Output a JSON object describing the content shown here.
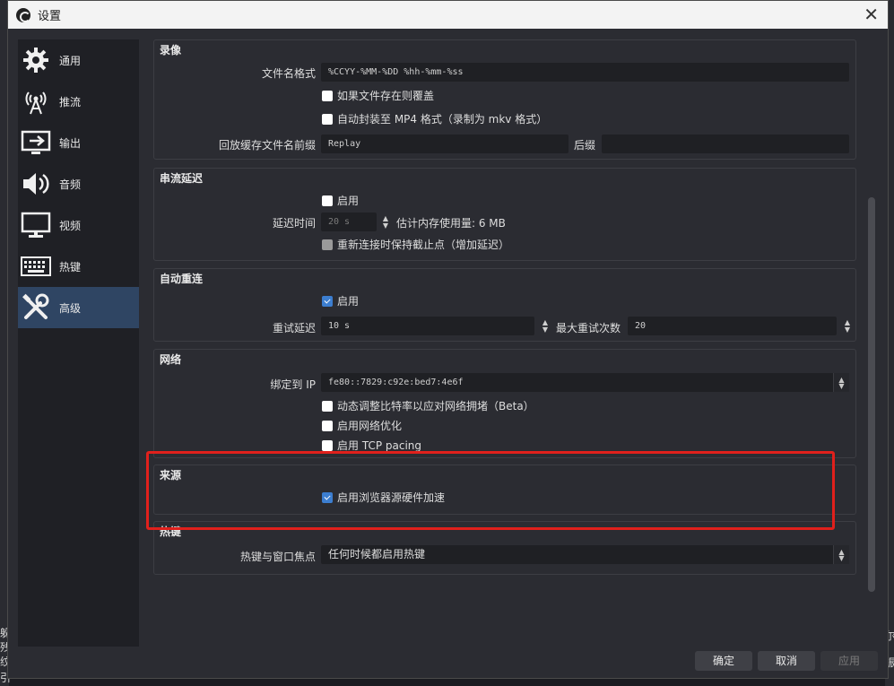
{
  "background": {
    "left_fragments": [
      "躲",
      "残",
      "纹",
      "引未弗"
    ],
    "right_fragments": [
      "尔",
      "振"
    ]
  },
  "window": {
    "title": "设置",
    "close_glyph": "✕"
  },
  "sidebar": {
    "items": [
      {
        "label": "通用",
        "icon": "gear-icon"
      },
      {
        "label": "推流",
        "icon": "antenna-icon"
      },
      {
        "label": "输出",
        "icon": "output-icon"
      },
      {
        "label": "音频",
        "icon": "speaker-icon"
      },
      {
        "label": "视频",
        "icon": "monitor-icon"
      },
      {
        "label": "热键",
        "icon": "keyboard-icon"
      },
      {
        "label": "高级",
        "icon": "tools-icon",
        "active": true
      }
    ]
  },
  "recording": {
    "title": "录像",
    "filename_format_label": "文件名格式",
    "filename_format_value": "%CCYY-%MM-%DD %hh-%mm-%ss",
    "overwrite_label": "如果文件存在则覆盖",
    "overwrite_checked": false,
    "remux_label": "自动封装至 MP4 格式（录制为 mkv 格式）",
    "remux_checked": false,
    "replay_prefix_label": "回放缓存文件名前缀",
    "replay_prefix_value": "Replay",
    "suffix_label": "后缀",
    "suffix_value": ""
  },
  "stream_delay": {
    "title": "串流延迟",
    "enable_label": "启用",
    "enable_checked": false,
    "delay_label": "延迟时间",
    "delay_value": "20 s",
    "memory_estimate": "估计内存使用量: 6 MB",
    "preserve_label": "重新连接时保持截止点（增加延迟）",
    "preserve_checked": true
  },
  "auto_reconnect": {
    "title": "自动重连",
    "enable_label": "启用",
    "enable_checked": true,
    "retry_delay_label": "重试延迟",
    "retry_delay_value": "10 s",
    "max_retries_label": "最大重试次数",
    "max_retries_value": "20"
  },
  "network": {
    "title": "网络",
    "bind_ip_label": "绑定到 IP",
    "bind_ip_value": "fe80::7829:c92e:bed7:4e6f",
    "dynamic_bitrate_label": "动态调整比特率以应对网络拥堵（Beta）",
    "dynamic_bitrate_checked": false,
    "net_opt_label": "启用网络优化",
    "net_opt_checked": false,
    "tcp_pacing_label": "启用 TCP pacing",
    "tcp_pacing_checked": false
  },
  "sources": {
    "title": "来源",
    "browser_hw_label": "启用浏览器源硬件加速",
    "browser_hw_checked": true
  },
  "hotkeys": {
    "title": "热键",
    "focus_label": "热键与窗口焦点",
    "focus_value": "任何时候都启用热键"
  },
  "footer": {
    "ok": "确定",
    "cancel": "取消",
    "apply": "应用"
  },
  "colors": {
    "accent": "#3c7ed0",
    "highlight": "#e0201c",
    "active_nav": "#2f4563"
  }
}
